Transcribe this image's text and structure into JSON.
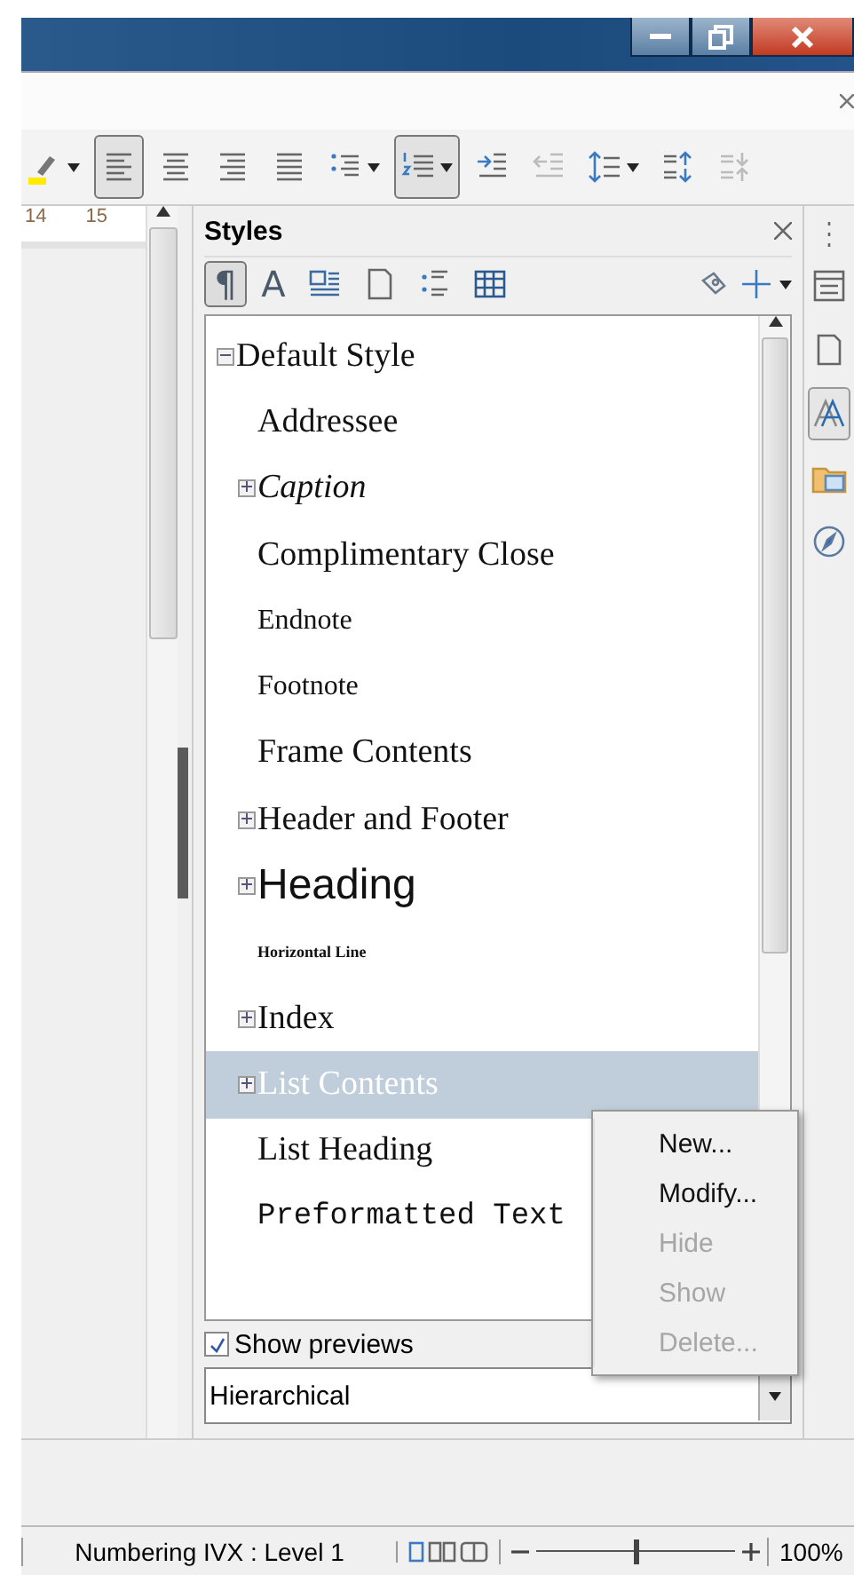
{
  "toolbar": [
    {
      "kind": "highlight",
      "selected": false,
      "menu": true
    },
    {
      "kind": "align-left",
      "selected": true,
      "menu": false
    },
    {
      "kind": "align-center",
      "selected": false,
      "menu": false
    },
    {
      "kind": "align-right",
      "selected": false,
      "menu": false
    },
    {
      "kind": "justify",
      "selected": false,
      "menu": false
    },
    {
      "kind": "bullets",
      "selected": false,
      "menu": true
    },
    {
      "kind": "numbering",
      "selected": true,
      "menu": true
    },
    {
      "kind": "indent-more",
      "selected": false,
      "menu": false
    },
    {
      "kind": "indent-less",
      "selected": false,
      "menu": false,
      "disabled": true
    },
    {
      "kind": "line-spacing",
      "selected": false,
      "menu": true
    },
    {
      "kind": "space-more",
      "selected": false,
      "menu": false
    },
    {
      "kind": "space-less",
      "selected": false,
      "menu": false,
      "disabled": true
    }
  ],
  "ruler": [
    "14",
    "15"
  ],
  "styles_panel": {
    "title": "Styles",
    "families": [
      {
        "kind": "paragraph",
        "label": "¶",
        "selected": true
      },
      {
        "kind": "character",
        "label": "A",
        "selected": false
      },
      {
        "kind": "frame",
        "selected": false
      },
      {
        "kind": "page",
        "selected": false
      },
      {
        "kind": "list",
        "selected": false
      },
      {
        "kind": "table",
        "selected": false
      }
    ],
    "tree": [
      {
        "label": "Default Style",
        "kind": "serif",
        "expanded": true,
        "selected": false,
        "children": [
          {
            "label": "Addressee",
            "kind": "serif",
            "selected": false
          },
          {
            "label": "Caption",
            "kind": "italic",
            "expanded": false,
            "selected": false
          },
          {
            "label": "Complimentary Close",
            "kind": "serif",
            "selected": false
          },
          {
            "label": "Endnote",
            "kind": "small",
            "selected": false
          },
          {
            "label": "Footnote",
            "kind": "small",
            "selected": false
          },
          {
            "label": "Frame Contents",
            "kind": "serif",
            "selected": false
          },
          {
            "label": "Header and Footer",
            "kind": "serif",
            "expanded": false,
            "selected": false
          },
          {
            "label": "Heading",
            "kind": "sans",
            "expanded": false,
            "selected": false
          },
          {
            "label": "Horizontal Line",
            "kind": "tiny",
            "selected": false
          },
          {
            "label": "Index",
            "kind": "serif",
            "expanded": false,
            "selected": false
          },
          {
            "label": "List Contents",
            "kind": "serif",
            "expanded": false,
            "selected": true
          },
          {
            "label": "List Heading",
            "kind": "serif",
            "selected": false
          },
          {
            "label": "Preformatted Text",
            "kind": "mono",
            "selected": false
          }
        ]
      }
    ],
    "show_previews": {
      "label": "Show previews",
      "checked": true
    },
    "filter": {
      "value": "Hierarchical"
    },
    "context_menu": [
      {
        "label": "New...",
        "disabled": false
      },
      {
        "label": "Modify...",
        "disabled": false
      },
      {
        "label": "Hide",
        "disabled": true
      },
      {
        "label": "Show",
        "disabled": true
      },
      {
        "label": "Delete...",
        "disabled": true
      }
    ]
  },
  "deck": [
    {
      "kind": "properties",
      "selected": false
    },
    {
      "kind": "page",
      "selected": false
    },
    {
      "kind": "styles",
      "selected": true
    },
    {
      "kind": "gallery",
      "selected": false
    },
    {
      "kind": "navigator",
      "selected": false
    }
  ],
  "status_bar": {
    "text": "Numbering IVX : Level 1",
    "zoom": {
      "level": 0.5,
      "reading": "100%"
    }
  }
}
